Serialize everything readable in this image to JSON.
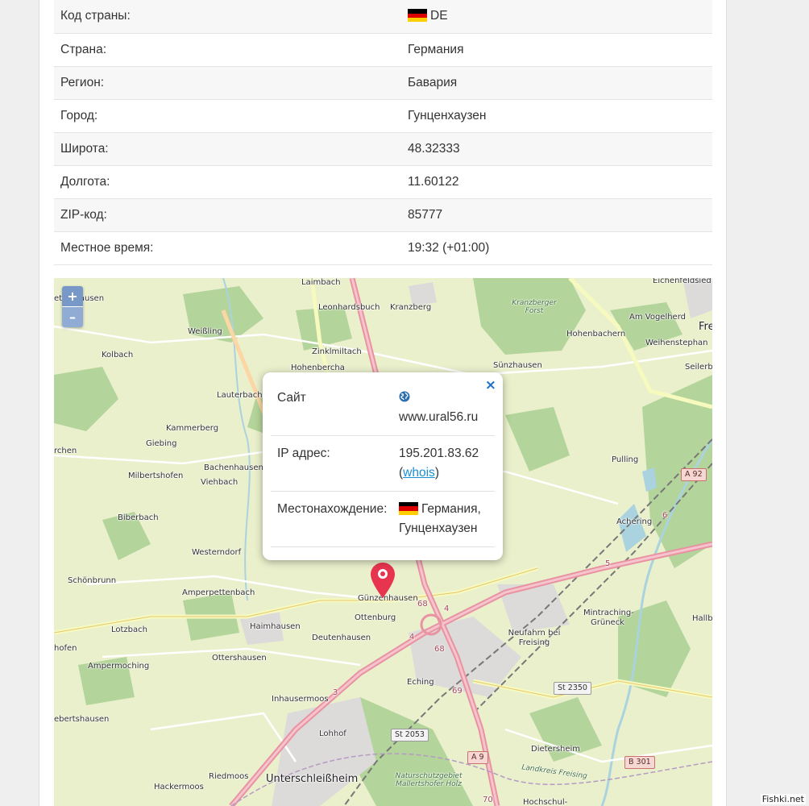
{
  "info_table": [
    {
      "label": "Код страны:",
      "value": "DE",
      "flag": true
    },
    {
      "label": "Страна:",
      "value": "Германия"
    },
    {
      "label": "Регион:",
      "value": "Бавария"
    },
    {
      "label": "Город:",
      "value": "Гунценхаузен"
    },
    {
      "label": "Широта:",
      "value": "48.32333"
    },
    {
      "label": "Долгота:",
      "value": "11.60122"
    },
    {
      "label": "ZIP-код:",
      "value": "85777"
    },
    {
      "label": "Местное время:",
      "value": "19:32 (+01:00)"
    }
  ],
  "map": {
    "zoom_in": "+",
    "zoom_out": "–",
    "labels": [
      "Laimbach",
      "Leonhardsbuch",
      "Kranzberg",
      "Eichenfeldsied",
      "Am Vogelherd",
      "Fre",
      "Hohenbachern",
      "Weihenstephan",
      "Seilerb",
      "Sünzhausen",
      "Weißling",
      "Kolbach",
      "Zinklmiltach",
      "Hohenbercha",
      "Lauterbach",
      "Kammerberg",
      "Giebing",
      "Bachenhausen",
      "Milbertshofen",
      "Viehbach",
      "Pulling",
      "Achering",
      "Biberbach",
      "Westerndorf",
      "Schönbrunn",
      "Amperpettenbach",
      "Günzenhausen",
      "Ottenburg",
      "Haimhausen",
      "Deutenhausen",
      "Lotzbach",
      "Neufahrn bei Freising",
      "Mintraching-Grüneck",
      "Hallb",
      "Ampermoching",
      "Ottershausen",
      "Eching",
      "Inhausermoos",
      "Lohhof",
      "Dietersheim",
      "Hackermoos",
      "Riedmoos",
      "Unterschleißheim",
      "Hochschul-",
      "etershausen",
      "rchen",
      "hofen",
      "ebertshausen",
      "Landkreis Freising"
    ],
    "forest_labels": [
      "Kranzberger Forst",
      "Naturschutzgebiet Mallertshofer Holz"
    ],
    "road_shields": [
      "A 92",
      "A 9",
      "B 301",
      "St 2350",
      "St 2053"
    ],
    "road_numbers": [
      "68",
      "4",
      "4",
      "68",
      "69",
      "6",
      "5",
      "3",
      "70"
    ]
  },
  "popup": {
    "close_icon": "×",
    "site_label": "Сайт",
    "site_value": "www.ural56.ru",
    "ip_label": "IP адрес:",
    "ip_value": "195.201.83.62",
    "ip_open": "(",
    "whois": "whois",
    "ip_close": ")",
    "location_label": "Местонахождение:",
    "location_country": "Германия,",
    "location_city": "Гунценхаузен"
  },
  "flag_colors": [
    "#000000",
    "#dd0000",
    "#ffce00"
  ],
  "pin_color": "#e8354f",
  "watermark": "Fishki.net"
}
